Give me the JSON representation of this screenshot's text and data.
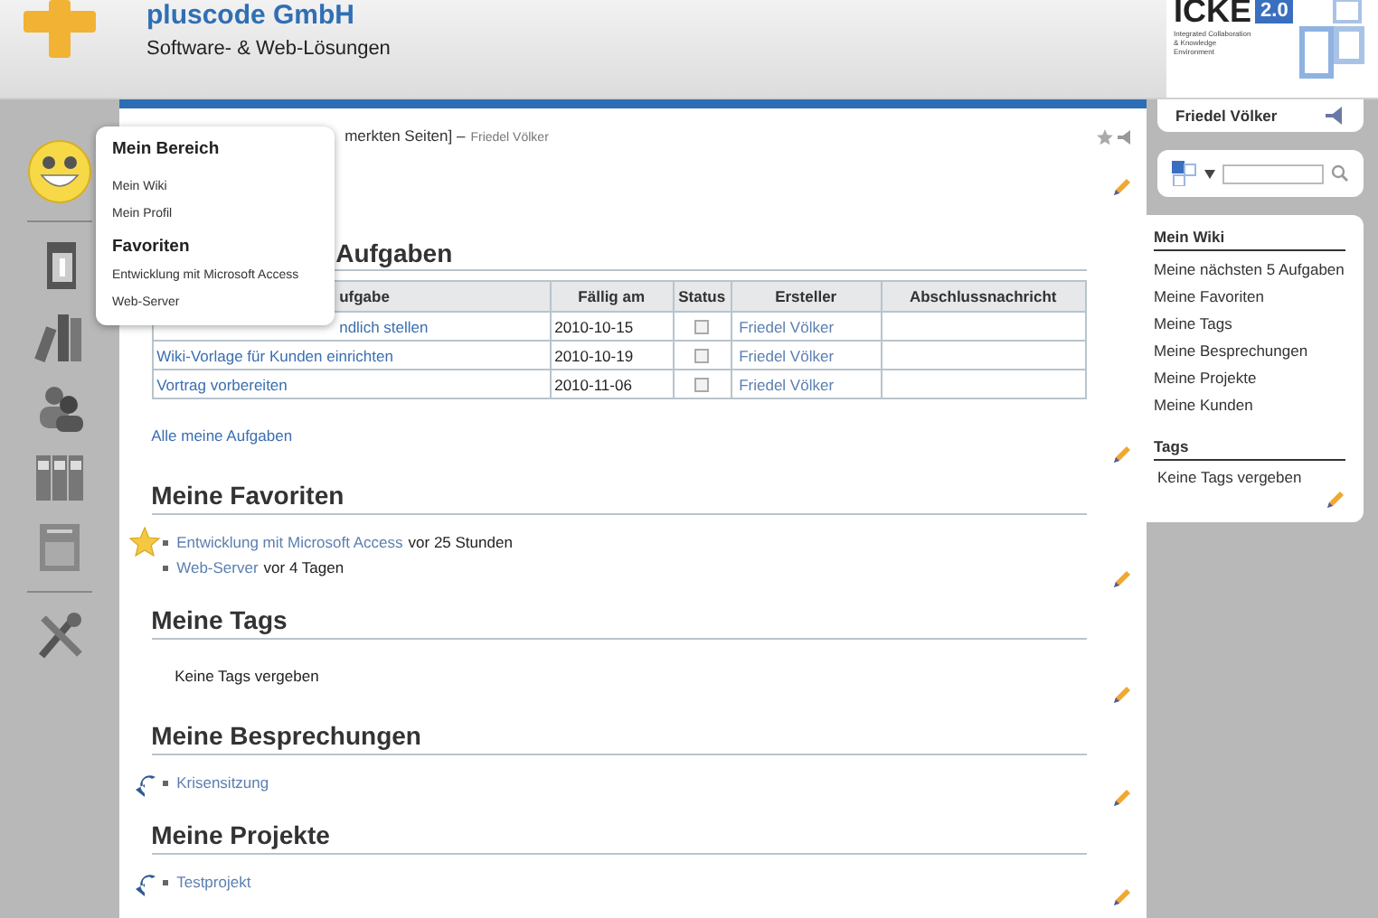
{
  "header": {
    "company": "pluscode GmbH",
    "tagline": "Software- & Web-Lösungen"
  },
  "product_logo": {
    "name": "ICKE",
    "version": "2.0",
    "subtitle": "Integrated Collaboration & Knowledge Environment"
  },
  "breadcrumb": {
    "text": "merkten Seiten] –",
    "user": "Friedel Völker"
  },
  "popup": {
    "sections": [
      {
        "title": "Mein Bereich",
        "items": [
          "Mein Wiki",
          "Mein Profil"
        ]
      },
      {
        "title": "Favoriten",
        "items": [
          "Entwicklung mit Microsoft Access",
          "Web-Server"
        ]
      }
    ]
  },
  "sections": [
    {
      "kind": "tasks",
      "title": "Aufgaben",
      "columns": [
        "ufgabe",
        "Fällig am",
        "Status",
        "Ersteller",
        "Abschlussnachricht"
      ],
      "rows": [
        {
          "task": "ndlich stellen",
          "due": "2010-10-15",
          "checked": false,
          "creator": "Friedel Völker"
        },
        {
          "task": "Wiki-Vorlage für Kunden einrichten",
          "due": "2010-10-19",
          "checked": false,
          "creator": "Friedel Völker"
        },
        {
          "task": "Vortrag vorbereiten",
          "due": "2010-11-06",
          "checked": false,
          "creator": "Friedel Völker"
        }
      ],
      "link": "Alle meine Aufgaben"
    },
    {
      "kind": "favorites",
      "title": "Meine Favoriten",
      "items": [
        {
          "label": "Entwicklung mit Microsoft Access",
          "time": "vor 25 Stunden"
        },
        {
          "label": "Web-Server",
          "time": "vor 4 Tagen"
        }
      ]
    },
    {
      "kind": "text",
      "title": "Meine Tags",
      "text": "Keine Tags vergeben"
    },
    {
      "kind": "links",
      "title": "Meine Besprechungen",
      "items": [
        "Krisensitzung"
      ]
    },
    {
      "kind": "links",
      "title": "Meine Projekte",
      "items": [
        "Testprojekt"
      ]
    }
  ],
  "right": {
    "user": "Friedel Völker",
    "wiki": {
      "title": "Mein Wiki",
      "items": [
        "Meine nächsten 5 Aufgaben",
        "Meine Favoriten",
        "Meine Tags",
        "Meine Besprechungen",
        "Meine Projekte",
        "Meine Kunden"
      ]
    },
    "tags": {
      "title": "Tags",
      "text": "Keine Tags vergeben"
    }
  }
}
